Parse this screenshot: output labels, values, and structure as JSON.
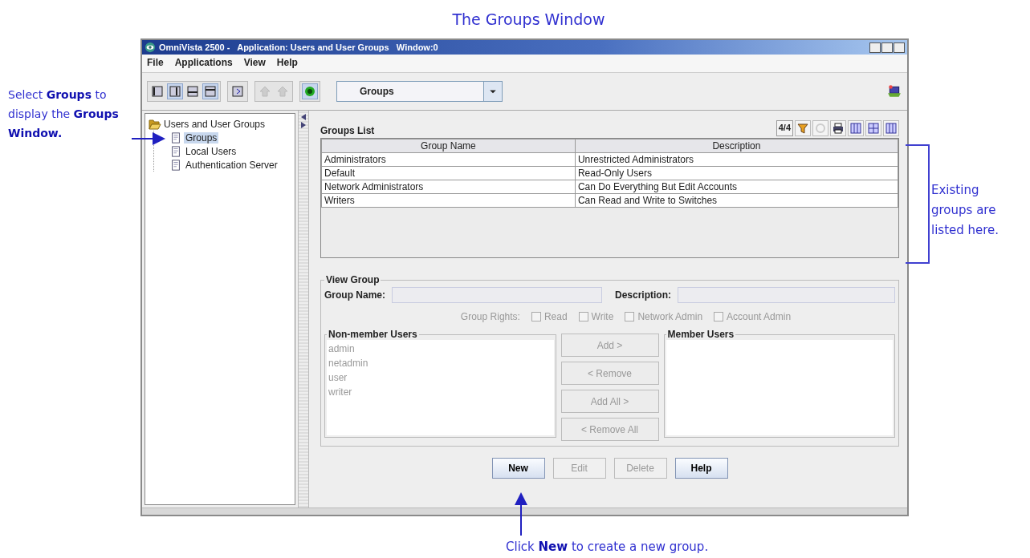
{
  "annotations": {
    "heading": "The Groups Window",
    "select_hint": "Select **Groups** to display the **Groups Window.**",
    "list_hint": "Existing groups are listed here.",
    "new_hint": "Click **New** to create a new group."
  },
  "window": {
    "title": "OmniVista 2500 -   Application: Users and User Groups   Window:0"
  },
  "menu": [
    "File",
    "Applications",
    "View",
    "Help"
  ],
  "toolbar": {
    "view_selector": "Groups"
  },
  "tree": {
    "label": "Users and User Groups",
    "expanded": true,
    "children": [
      {
        "label": "Groups",
        "selected": true
      },
      {
        "label": "Local Users",
        "selected": false
      },
      {
        "label": "Authentication Server",
        "selected": false
      }
    ]
  },
  "groups_list": {
    "title": "Groups List",
    "count": "4/4",
    "columns": [
      "Group Name",
      "Description"
    ],
    "rows": [
      [
        "Administrators",
        "Unrestricted Administrators"
      ],
      [
        "Default",
        "Read-Only Users"
      ],
      [
        "Network Administrators",
        "Can Do Everything But Edit Accounts"
      ],
      [
        "Writers",
        "Can Read and Write to Switches"
      ]
    ]
  },
  "view_group": {
    "title": "View Group",
    "group_name_label": "Group Name:",
    "description_label": "Description:",
    "rights_label": "Group Rights:",
    "rights": [
      {
        "label": "Read",
        "checked": false,
        "disabled": true
      },
      {
        "label": "Write",
        "checked": false,
        "disabled": true
      },
      {
        "label": "Network Admin",
        "checked": false,
        "disabled": true
      },
      {
        "label": "Account Admin",
        "checked": false,
        "disabled": true
      }
    ],
    "non_members": {
      "title": "Non-member Users",
      "disabled": true,
      "users": [
        "admin",
        "netadmin",
        "user",
        "writer"
      ]
    },
    "members": {
      "title": "Member Users"
    },
    "transfer_buttons": [
      {
        "label": "Add >",
        "disabled": true
      },
      {
        "label": "< Remove",
        "disabled": true
      },
      {
        "label": "Add All >",
        "disabled": true
      },
      {
        "label": "< Remove All",
        "disabled": true
      }
    ]
  },
  "buttons": [
    {
      "label": "New",
      "disabled": false
    },
    {
      "label": "Edit",
      "disabled": true
    },
    {
      "label": "Delete",
      "disabled": true
    },
    {
      "label": "Help",
      "disabled": false
    }
  ]
}
